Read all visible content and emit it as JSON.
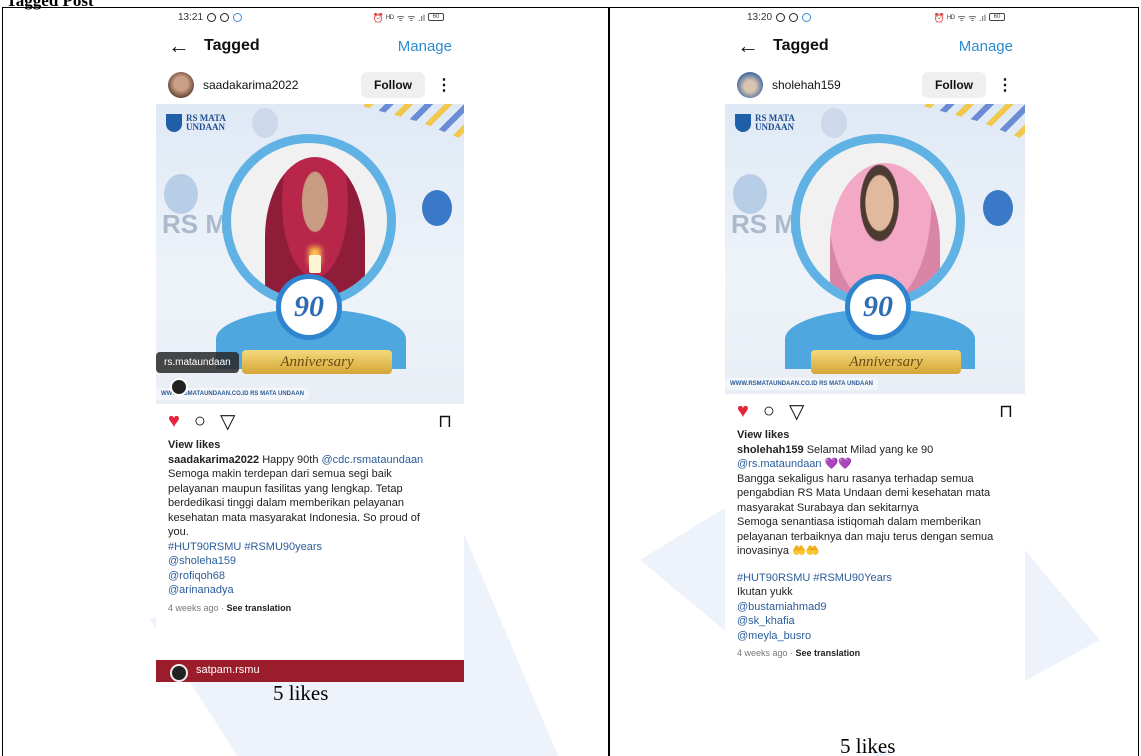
{
  "document": {
    "heading": "Tagged Post"
  },
  "colors": {
    "accent_link": "#2d8ccf",
    "like_red": "#e3243b",
    "mention_blue": "#2b5d9b"
  },
  "panels": [
    {
      "status_time": "13:21",
      "status_right": "⏰ ᴴᴰ ᯤ ᯤ .ıl",
      "battery": "60",
      "header": {
        "title": "Tagged",
        "manage": "Manage"
      },
      "user": {
        "name": "saadakarima2022",
        "follow": "Follow"
      },
      "image": {
        "brand_line1": "RS MATA",
        "brand_line2": "UNDAAN",
        "rs_ghost": "RS M",
        "anniversary": "Anniversary",
        "url_strip": "WWW.RSMATAUNDAAN.CO.ID  RS MATA UNDAAN",
        "tag_bubble": "rs.mataundaan"
      },
      "view_likes": "View likes",
      "caption": {
        "user": "saadakarima2022",
        "first": " Happy 90th ",
        "first_mention": "@cdc.rsmataundaan",
        "lines": [
          "Semoga makin terdepan dari semua segi baik",
          "pelayanan maupun fasilitas yang lengkap. Tetap",
          "berdedikasi tinggi dalam memberikan pelayanan",
          "kesehatan mata masyarakat Indonesia. So proud of",
          "you."
        ],
        "hashtags": "#HUT90RSMU #RSMU90years",
        "mentions": [
          "@sholeha159",
          "@rofiqoh68",
          "@arinanadya"
        ]
      },
      "time_ago": "4 weeks ago",
      "separator": " · ",
      "see_translation": "See translation",
      "next_post_user": "satpam.rsmu",
      "likes_label": "5 likes"
    },
    {
      "status_time": "13:20",
      "status_right": "⏰ ᴴᴰ ᯤ ᯤ .ıl",
      "battery": "60",
      "header": {
        "title": "Tagged",
        "manage": "Manage"
      },
      "user": {
        "name": "sholehah159",
        "follow": "Follow"
      },
      "image": {
        "brand_line1": "RS MATA",
        "brand_line2": "UNDAAN",
        "rs_ghost": "RS M",
        "anniversary": "Anniversary",
        "url_strip": "WWW.RSMATAUNDAAN.CO.ID  RS MATA UNDAAN"
      },
      "view_likes": "View likes",
      "caption": {
        "user": "sholehah159",
        "first": " Selamat Milad yang ke 90",
        "first_mention": "@rs.mataundaan",
        "first_mention_suffix": " 💜💜",
        "lines": [
          "Bangga sekaligus haru rasanya terhadap semua",
          "pengabdian RS Mata Undaan demi kesehatan mata",
          "masyarakat Surabaya dan sekitarnya",
          "Semoga senantiasa istiqomah dalam memberikan",
          "pelayanan terbaiknya dan maju terus dengan semua",
          "inovasinya 🤲🤲"
        ],
        "hashtags": "#HUT90RSMU #RSMU90Years",
        "extra": "Ikutan yukk",
        "mentions": [
          "@bustamiahmad9",
          "@sk_khafia",
          "@meyla_busro"
        ]
      },
      "time_ago": "4 weeks ago",
      "separator": " · ",
      "see_translation": "See translation",
      "likes_label": "5 likes"
    }
  ]
}
